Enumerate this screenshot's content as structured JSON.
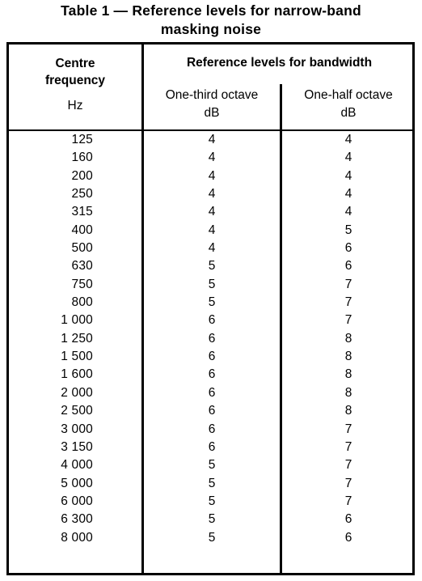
{
  "title": "Table 1 — Reference levels for narrow-band\nmasking noise",
  "header": {
    "freq_title": "Centre\nfrequency",
    "freq_unit": "Hz",
    "span_title": "Reference levels for bandwidth",
    "sub_one_third": "One-third octave\ndB",
    "sub_one_half": "One-half octave\ndB"
  },
  "columns": [
    "Centre frequency Hz",
    "One-third octave dB",
    "One-half octave dB"
  ],
  "rows": [
    {
      "frequency": "125",
      "one_third": "4",
      "one_half": "4"
    },
    {
      "frequency": "160",
      "one_third": "4",
      "one_half": "4"
    },
    {
      "frequency": "200",
      "one_third": "4",
      "one_half": "4"
    },
    {
      "frequency": "250",
      "one_third": "4",
      "one_half": "4"
    },
    {
      "frequency": "315",
      "one_third": "4",
      "one_half": "4"
    },
    {
      "frequency": "400",
      "one_third": "4",
      "one_half": "5"
    },
    {
      "frequency": "500",
      "one_third": "4",
      "one_half": "6"
    },
    {
      "frequency": "630",
      "one_third": "5",
      "one_half": "6"
    },
    {
      "frequency": "750",
      "one_third": "5",
      "one_half": "7"
    },
    {
      "frequency": "800",
      "one_third": "5",
      "one_half": "7"
    },
    {
      "frequency": "1 000",
      "one_third": "6",
      "one_half": "7"
    },
    {
      "frequency": "1 250",
      "one_third": "6",
      "one_half": "8"
    },
    {
      "frequency": "1 500",
      "one_third": "6",
      "one_half": "8"
    },
    {
      "frequency": "1 600",
      "one_third": "6",
      "one_half": "8"
    },
    {
      "frequency": "2 000",
      "one_third": "6",
      "one_half": "8"
    },
    {
      "frequency": "2 500",
      "one_third": "6",
      "one_half": "8"
    },
    {
      "frequency": "3 000",
      "one_third": "6",
      "one_half": "7"
    },
    {
      "frequency": "3 150",
      "one_third": "6",
      "one_half": "7"
    },
    {
      "frequency": "4 000",
      "one_third": "5",
      "one_half": "7"
    },
    {
      "frequency": "5 000",
      "one_third": "5",
      "one_half": "7"
    },
    {
      "frequency": "6 000",
      "one_third": "5",
      "one_half": "7"
    },
    {
      "frequency": "6 300",
      "one_third": "5",
      "one_half": "6"
    },
    {
      "frequency": "8 000",
      "one_third": "5",
      "one_half": "6"
    }
  ],
  "colors": {
    "text": "#000000",
    "background": "#ffffff",
    "rule": "#000000"
  }
}
